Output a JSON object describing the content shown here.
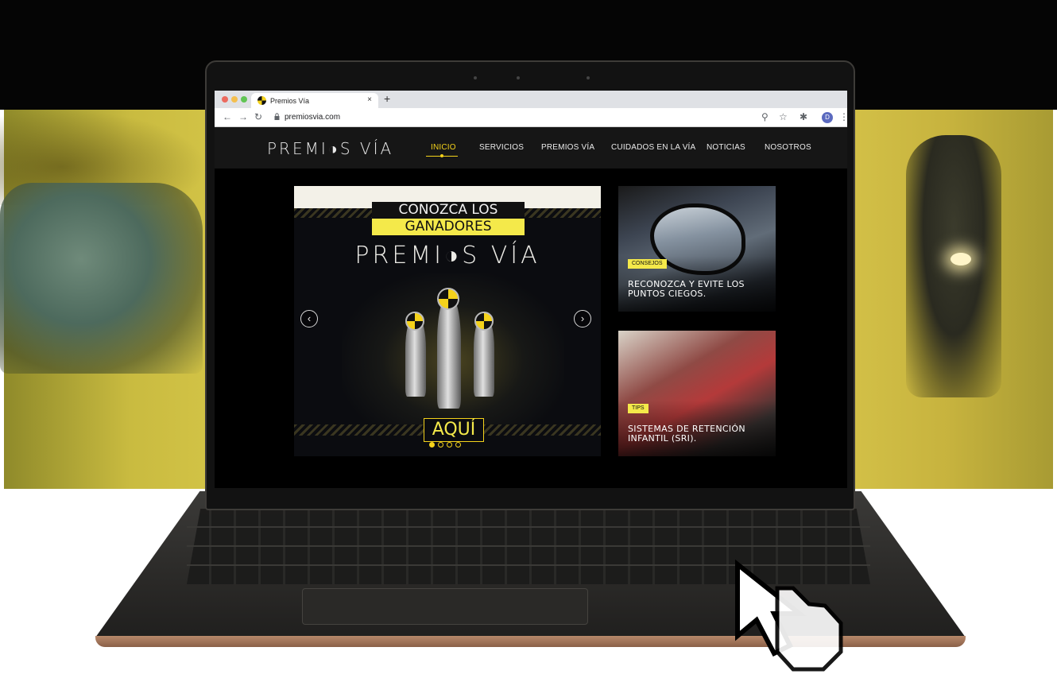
{
  "browser": {
    "tab_title": "Premios Vía",
    "tab_close": "×",
    "new_tab": "+",
    "url": "premiosvia.com",
    "profile_initial": "D",
    "icons": [
      "back-icon",
      "forward-icon",
      "reload-icon",
      "lock-icon",
      "zoom-icon",
      "star-icon",
      "extensions-icon",
      "menu-icon"
    ]
  },
  "site": {
    "logo": "PREMI◑S VÍA",
    "nav": [
      {
        "label": "INICIO",
        "active": true
      },
      {
        "label": "SERVICIOS"
      },
      {
        "label": "PREMIOS VÍA"
      },
      {
        "label": "CUIDADOS EN LA VÍA"
      },
      {
        "label": "NOTICIAS"
      },
      {
        "label": "NOSOTROS"
      }
    ],
    "slider": {
      "banner_line1": "CONOZCA LOS",
      "banner_line2": "GANADORES",
      "brand": "PREMI◑S VÍA",
      "cta": "AQUÍ",
      "prev": "‹",
      "next": "›",
      "dots_total": 4,
      "dot_active": 1
    },
    "cards": [
      {
        "tag": "CONSEJOS",
        "title": "RECONOZCA Y EVITE LOS PUNTOS CIEGOS."
      },
      {
        "tag": "TIPS",
        "title": "SISTEMAS DE RETENCIÓN INFANTIL (SRI)."
      }
    ]
  },
  "colors": {
    "accent": "#f4d21b",
    "banner_yellow": "#f4e94a",
    "header_bg": "#161616"
  }
}
